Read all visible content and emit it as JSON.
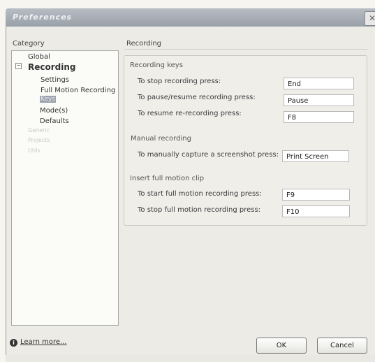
{
  "window": {
    "title": "Preferences"
  },
  "category": {
    "label": "Category",
    "items": [
      {
        "label": "Global"
      },
      {
        "label": "Recording"
      },
      {
        "label": "Settings"
      },
      {
        "label": "Full Motion Recording"
      },
      {
        "label": "Keys"
      },
      {
        "label": "Mode(s)"
      },
      {
        "label": "Defaults"
      },
      {
        "label": "Generic"
      },
      {
        "label": "Projects"
      },
      {
        "label": "Utils"
      }
    ]
  },
  "main": {
    "section_title": "Recording",
    "recording_keys": {
      "group_label": "Recording keys",
      "rows": [
        {
          "label": "To stop recording press:",
          "value": "End"
        },
        {
          "label": "To pause/resume recording press:",
          "value": "Pause"
        },
        {
          "label": "To resume re-recording press:",
          "value": "F8"
        }
      ]
    },
    "manual_recording": {
      "group_label": "Manual recording",
      "rows": [
        {
          "label": "To manually capture a screenshot press:",
          "value": "Print Screen"
        }
      ]
    },
    "full_motion": {
      "group_label": "Insert full motion clip",
      "rows": [
        {
          "label": "To start full motion recording press:",
          "value": "F9"
        },
        {
          "label": "To stop full motion recording press:",
          "value": "F10"
        }
      ]
    }
  },
  "footer": {
    "help_link": "Learn more...",
    "ok_label": "OK",
    "cancel_label": "Cancel"
  },
  "icons": {
    "close": "close-icon",
    "help": "info-icon",
    "expander": "collapse-icon"
  }
}
